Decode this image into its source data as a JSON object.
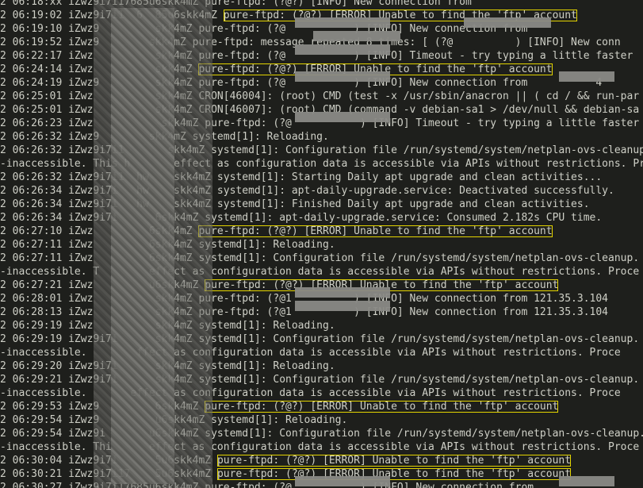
{
  "log_lines": [
    {
      "text": "2 06:18:xx iZwz9i7i17685u6skk4mZ pure-ftpd: (?@?) [INFO] New connection from",
      "highlight": false
    },
    {
      "text": "2 06:19:02 iZwz9i7i1  6  85u6skk4mZ pure-ftpd: (?@?) [ERROR] Unable to find the 'ftp' account",
      "highlight": true
    },
    {
      "text": "2 06:19:10 iZwz9         skk4mZ pure-ftpd: (?@           ) [INFO] New connection from",
      "highlight": false
    },
    {
      "text": "2 06:19:52 iZwz9        skk4mZ pure-ftpd: message repeated 8 times: [ (?@          ) [INFO] New conn",
      "highlight": false
    },
    {
      "text": "2 06:22:17 iZwz          skk4mZ pure-ftpd: (?@           ) [INFO] Timeout - try typing a little faster",
      "highlight": false
    },
    {
      "text": "2 06:24:14 iZwz          skk4mZ pure-ftpd: (?@?) [ERROR] Unable to find the 'ftp' account",
      "highlight": true
    },
    {
      "text": "2 06:24:19 iZwz9         skk4mZ pure-ftpd: (?@           ) [INFO] New connection from           4",
      "highlight": false
    },
    {
      "text": "2 06:25:01 iZwz          skk4mZ CRON[46004]: (root) CMD (test -x /usr/sbin/anacron || ( cd / && run-par",
      "highlight": false
    },
    {
      "text": "2 06:25:01 iZwz          skk4mZ CRON[46007]: (root) CMD (command -v debian-sa1 > /dev/null && debian-sa",
      "highlight": false
    },
    {
      "text": "2 06:26:23 iZwz           skk4mZ pure-ftpd: (?@           ) [INFO] Timeout - try typing a little faster",
      "highlight": false
    },
    {
      "text": "2 06:26:32 iZwz9        skk4mZ systemd[1]: Reloading.",
      "highlight": false
    },
    {
      "text": "2 06:26:32 iZwz9i7i1       skk4mZ systemd[1]: Configuration file /run/systemd/system/netplan-ovs-cleanup.",
      "highlight": false
    },
    {
      "text": "-inaccessible. This h       effect as configuration data is accessible via APIs without restrictions. Proce",
      "highlight": false
    },
    {
      "text": "2 06:26:32 iZwz9i7i1  hw    skk4mZ systemd[1]: Starting Daily apt upgrade and clean activities...",
      "highlight": false
    },
    {
      "text": "2 06:26:34 iZwz9i7i   hw    skk4mZ systemd[1]: apt-daily-upgrade.service: Deactivated successfully.",
      "highlight": false
    },
    {
      "text": "2 06:26:34 iZwz9i7i   hw    skk4mZ systemd[1]: Finished Daily apt upgrade and clean activities.",
      "highlight": false
    },
    {
      "text": "2 06:26:34 iZwz9i7i      6skk4mZ systemd[1]: apt-daily-upgrade.service: Consumed 2.182s CPU time.",
      "highlight": false
    },
    {
      "text": "2 06:27:10 iZwz         6skk4mZ pure-ftpd: (?@?) [ERROR] Unable to find the 'ftp' account",
      "highlight": true
    },
    {
      "text": "2 06:27:11 iZwz         6skk4mZ systemd[1]: Reloading.",
      "highlight": false
    },
    {
      "text": "2 06:27:11 iZwz         6skk4mZ systemd[1]: Configuration file /run/systemd/system/netplan-ovs-cleanup.",
      "highlight": false
    },
    {
      "text": "-inaccessible. T        effect as configuration data is accessible via APIs without restrictions. Proce",
      "highlight": false
    },
    {
      "text": "2 06:27:21 iZwz         u6skk4mZ pure-ftpd: (?@?) [ERROR] Unable to find the 'ftp' account",
      "highlight": true
    },
    {
      "text": "2 06:28:01 iZwz          skk4mZ pure-ftpd: (?@1          ) [INFO] New connection from 121.35.3.104",
      "highlight": false
    },
    {
      "text": "2 06:28:13 iZwz          skk4mZ pure-ftpd: (?@1          ) [INFO] New connection from 121.35.3.104",
      "highlight": false
    },
    {
      "text": "2 06:29:19 iZwz          skk4mZ systemd[1]: Reloading.",
      "highlight": false
    },
    {
      "text": "2 06:29:19 iZwz9i7i      skk4mZ systemd[1]: Configuration file /run/systemd/system/netplan-ovs-cleanup.",
      "highlight": false
    },
    {
      "text": "-inaccessible.        ffect as configuration data is accessible via APIs without restrictions. Proce",
      "highlight": false
    },
    {
      "text": "2 06:29:20 iZwz9i7i      skk4mZ systemd[1]: Reloading.",
      "highlight": false
    },
    {
      "text": "2 06:29:21 iZwz9i7i      skk4mZ systemd[1]: Configuration file /run/systemd/system/netplan-ovs-cleanup.",
      "highlight": false
    },
    {
      "text": "-inaccessible.       effect as configuration data is accessible via APIs without restrictions. Proce",
      "highlight": false
    },
    {
      "text": "2 06:29:53 iZwz9         6skk4mZ pure-ftpd: (?@?) [ERROR] Unable to find the 'ftp' account",
      "highlight": true
    },
    {
      "text": "2 06:29:54 iZwz9         u6skk4mZ systemd[1]: Reloading.",
      "highlight": false
    },
    {
      "text": "2 06:29:54 iZwz9i       u6skk4mZ systemd[1]: Configuration file /run/systemd/system/netplan-ovs-cleanup.",
      "highlight": false
    },
    {
      "text": "-inaccessible. Thi      effect as configuration data is accessible via APIs without restrictions. Proce",
      "highlight": false
    },
    {
      "text": "2 06:30:04 iZwz9i7i      5u6skk4mZ pure-ftpd: (?@?) [ERROR] Unable to find the 'ftp' account",
      "highlight": true
    },
    {
      "text": "2 06:30:21 iZwz9i7i17    5u6skk4mZ pure-ftpd: (?@?) [ERROR] Unable to find the 'ftp' account",
      "highlight": true
    },
    {
      "text": "2 06:30:27 iZwz9i7i17685u6skk4mZ pure-ftpd: (?@           ) [INFO] New connection from",
      "highlight": false
    }
  ]
}
